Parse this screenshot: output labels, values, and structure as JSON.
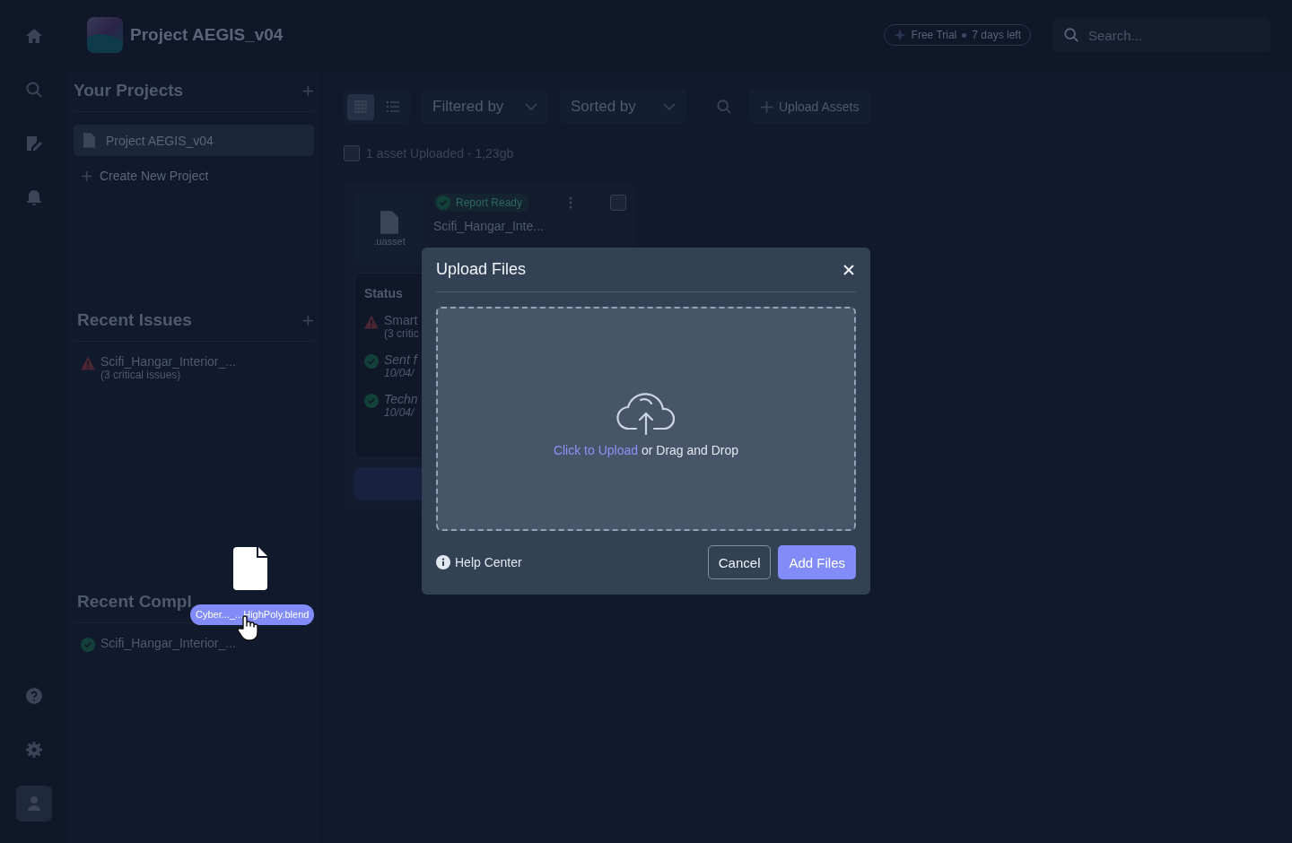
{
  "header": {
    "title": "Project AEGIS_v04",
    "trial": {
      "label": "Free Trial",
      "days": "7 days left"
    },
    "search": {
      "placeholder": "Search..."
    }
  },
  "sidebar": {
    "projects_title": "Your Projects",
    "projects": [
      {
        "name": "Project AEGIS_v04",
        "selected": true
      }
    ],
    "create_label": "Create New Project",
    "issues_title": "Recent Issues",
    "issues": [
      {
        "kind": "warning",
        "name": "Scifi_Hangar_Interior_...",
        "detail": "(3 critical issues)"
      }
    ],
    "completed_title": "Recent Compl",
    "completed": [
      {
        "kind": "done",
        "name": "Scifi_Hangar_Interior_..."
      }
    ]
  },
  "toolbar": {
    "view_modes": [
      {
        "kind": "grid",
        "selected": true
      },
      {
        "kind": "list",
        "selected": false
      }
    ],
    "filter": "Filtered by",
    "sort": "Sorted by",
    "upload": "Upload Assets"
  },
  "summary": {
    "checked": false,
    "text": "1 asset Uploaded - 1,23gb"
  },
  "asset": {
    "extension": ".uasset",
    "badge": "Report Ready",
    "name": "Scifi_Hangar_Inte...",
    "checked": false,
    "status_title": "Status",
    "status": [
      {
        "kind": "warning",
        "title": "Smart",
        "sub": "(3 critic"
      },
      {
        "kind": "done",
        "title": "Sent f",
        "sub": "10/04/"
      },
      {
        "kind": "done",
        "title": "Techn",
        "sub": "10/04/"
      }
    ]
  },
  "modal": {
    "title": "Upload Files",
    "link": "Click to Upload",
    "hint": "or Drag and Drop",
    "help": "Help Center",
    "cancel": "Cancel",
    "confirm": "Add Files"
  },
  "drag": {
    "file_name": "Cyber..._...HighPoly.blend"
  }
}
